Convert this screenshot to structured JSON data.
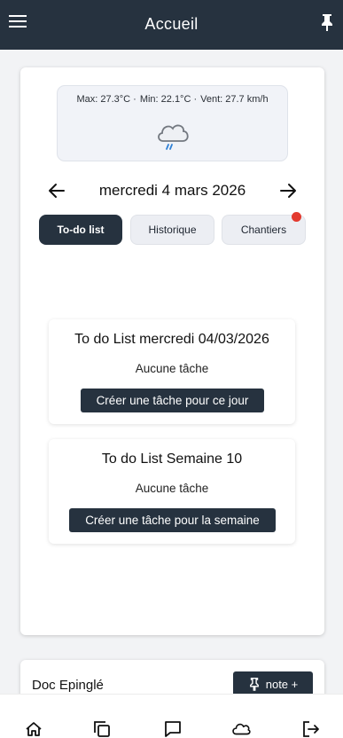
{
  "header": {
    "title": "Accueil",
    "menu_icon": "hamburger-menu-icon",
    "pin_icon": "pin-icon"
  },
  "weather": {
    "max": "Max: 27.3°C ·",
    "min": "Min: 22.1°C ·",
    "wind": "Vent: 27.7 km/h",
    "icon": "rain-cloud-icon"
  },
  "date_nav": {
    "date": "mercredi 4 mars 2026",
    "prev_icon": "arrow-left-icon",
    "next_icon": "arrow-right-icon"
  },
  "tabs": [
    {
      "label": "To-do list",
      "active": true
    },
    {
      "label": "Historique",
      "active": false
    },
    {
      "label": "Chantiers",
      "active": false,
      "badge": true
    }
  ],
  "todo_day": {
    "title": "To do List mercredi 04/03/2026",
    "empty": "Aucune tâche",
    "button": "Créer une tâche pour ce jour"
  },
  "todo_week": {
    "title": "To do List Semaine 10",
    "empty": "Aucune tâche",
    "button": "Créer une tâche pour la semaine"
  },
  "doc": {
    "label": "Doc Epinglé",
    "note_button": "note +"
  },
  "bottom_nav": [
    {
      "icon": "home-icon"
    },
    {
      "icon": "copy-icon"
    },
    {
      "icon": "chat-icon"
    },
    {
      "icon": "cloud-icon"
    },
    {
      "icon": "logout-icon"
    }
  ],
  "colors": {
    "primary": "#26323f",
    "badge": "#e33a2f",
    "background": "#f2f3f5"
  }
}
